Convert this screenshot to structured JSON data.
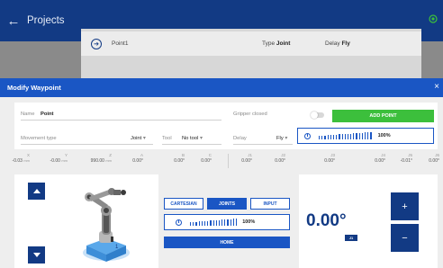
{
  "appbar": {
    "back_glyph": "←",
    "title": "Projects",
    "status_icon": "connection-icon",
    "status_color": "#3cbf3c"
  },
  "project_row": {
    "name": "Point1",
    "type_label": "Type",
    "type_value": "Joint",
    "delay_label": "Delay",
    "delay_value": "Fly"
  },
  "modal": {
    "title": "Modify Waypoint",
    "close_glyph": "×",
    "name_label": "Name",
    "name_value": "Point",
    "gripper_label": "Gripper closed",
    "add_point_label": "ADD POINT",
    "movement_label": "Movement type",
    "movement_value": "Joint",
    "tool_label": "Tool",
    "tool_value": "No tool",
    "delay_label": "Delay",
    "delay_value": "Fly",
    "caret": "▾",
    "speed_pct": "100%"
  },
  "positions": {
    "cartesian": [
      {
        "axis": "X",
        "value": "-0.03",
        "unit": "mm"
      },
      {
        "axis": "Y",
        "value": "-0.00",
        "unit": "mm"
      },
      {
        "axis": "Z",
        "value": "990.00",
        "unit": "mm"
      },
      {
        "axis": "A",
        "value": "0.00°",
        "unit": ""
      },
      {
        "axis": "B",
        "value": "0.00°",
        "unit": ""
      },
      {
        "axis": "C",
        "value": "0.00°",
        "unit": ""
      }
    ],
    "joints": [
      {
        "axis": "J1",
        "value": "0.00°"
      },
      {
        "axis": "J2",
        "value": "0.00°"
      },
      {
        "axis": "J3",
        "value": "0.00°"
      },
      {
        "axis": "J4",
        "value": "0.00°"
      },
      {
        "axis": "J5",
        "value": "-0.01°"
      },
      {
        "axis": "J6",
        "value": "0.00°"
      }
    ]
  },
  "controls": {
    "cartesian_label": "CARTESIAN",
    "joints_label": "JOINTS",
    "input_label": "INPUT",
    "speed_pct": "100%",
    "home_label": "HOME",
    "joint_value": "0.00°",
    "joint_badge": "J1",
    "plus_glyph": "+",
    "minus_glyph": "−"
  },
  "colors": {
    "brand_dark": "#123a84",
    "brand": "#1a56c4",
    "success": "#3cbf3c"
  }
}
